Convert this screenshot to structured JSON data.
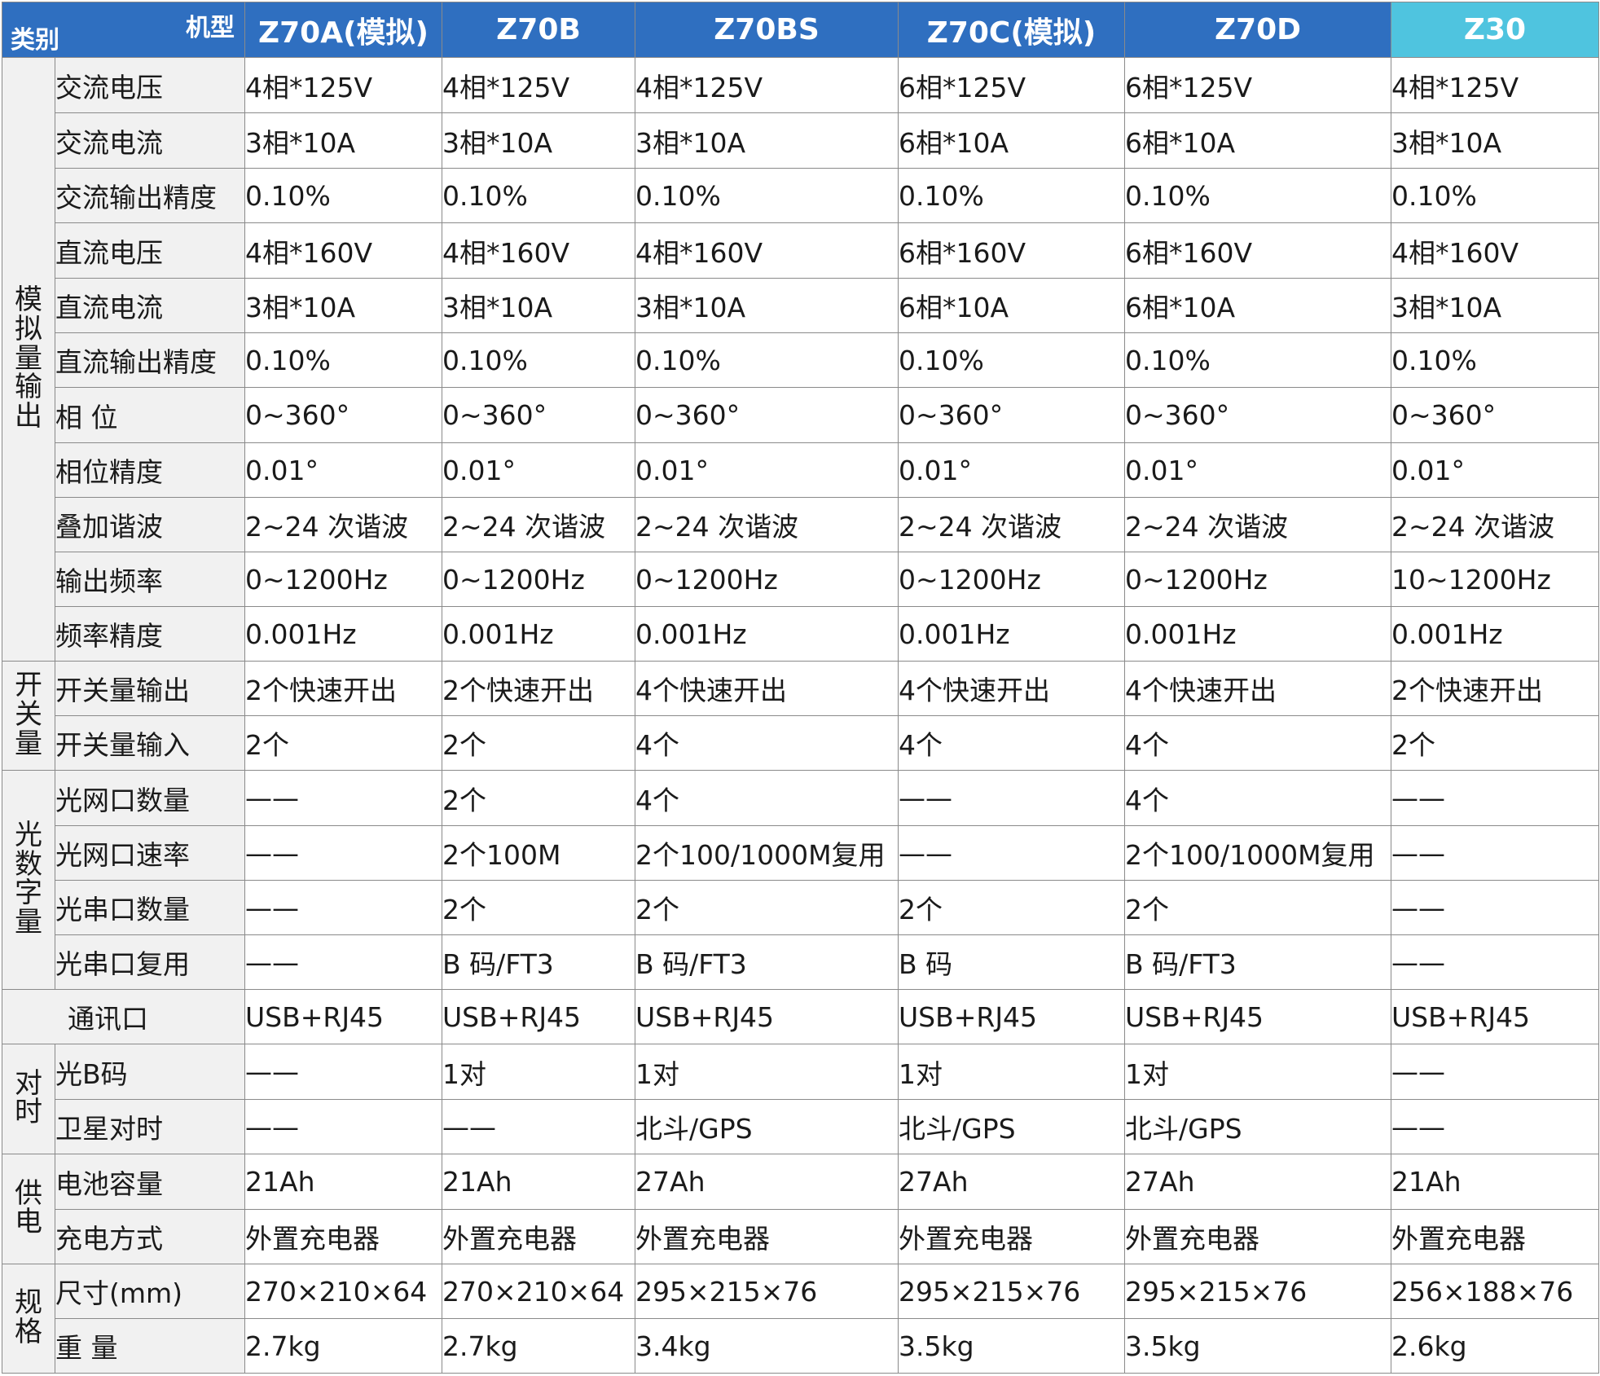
{
  "header": {
    "corner_class": "类别",
    "corner_model": "机型",
    "models": [
      "Z70A(模拟)",
      "Z70B",
      "Z70BS",
      "Z70C(模拟)",
      "Z70D",
      "Z30"
    ],
    "highlight_color": "#4fc4df",
    "header_color": "#2f6fc0"
  },
  "groups": [
    {
      "name": "模拟量输出",
      "rows": [
        {
          "param": "交流电压",
          "values": [
            "4相*125V",
            "4相*125V",
            "4相*125V",
            "6相*125V",
            "6相*125V",
            "4相*125V"
          ]
        },
        {
          "param": "交流电流",
          "values": [
            "3相*10A",
            "3相*10A",
            "3相*10A",
            "6相*10A",
            "6相*10A",
            "3相*10A"
          ]
        },
        {
          "param": "交流输出精度",
          "values": [
            "0.10%",
            "0.10%",
            "0.10%",
            "0.10%",
            "0.10%",
            "0.10%"
          ]
        },
        {
          "param": "直流电压",
          "values": [
            "4相*160V",
            "4相*160V",
            "4相*160V",
            "6相*160V",
            "6相*160V",
            "4相*160V"
          ]
        },
        {
          "param": "直流电流",
          "values": [
            "3相*10A",
            "3相*10A",
            "3相*10A",
            "6相*10A",
            "6相*10A",
            "3相*10A"
          ]
        },
        {
          "param": "直流输出精度",
          "values": [
            "0.10%",
            "0.10%",
            "0.10%",
            "0.10%",
            "0.10%",
            "0.10%"
          ]
        },
        {
          "param": "相 位",
          "values": [
            "0~360°",
            "0~360°",
            "0~360°",
            "0~360°",
            "0~360°",
            "0~360°"
          ]
        },
        {
          "param": "相位精度",
          "values": [
            "0.01°",
            "0.01°",
            "0.01°",
            "0.01°",
            "0.01°",
            "0.01°"
          ]
        },
        {
          "param": "叠加谐波",
          "values": [
            "2~24 次谐波",
            "2~24 次谐波",
            "2~24 次谐波",
            "2~24 次谐波",
            "2~24 次谐波",
            "2~24 次谐波"
          ]
        },
        {
          "param": "输出频率",
          "values": [
            "0~1200Hz",
            "0~1200Hz",
            "0~1200Hz",
            "0~1200Hz",
            "0~1200Hz",
            "10~1200Hz"
          ]
        },
        {
          "param": "频率精度",
          "values": [
            "0.001Hz",
            "0.001Hz",
            "0.001Hz",
            "0.001Hz",
            "0.001Hz",
            "0.001Hz"
          ]
        }
      ]
    },
    {
      "name": "开关量",
      "rows": [
        {
          "param": "开关量输出",
          "values": [
            "2个快速开出",
            "2个快速开出",
            "4个快速开出",
            "4个快速开出",
            "4个快速开出",
            "2个快速开出"
          ]
        },
        {
          "param": "开关量输入",
          "values": [
            "2个",
            "2个",
            "4个",
            "4个",
            "4个",
            "2个"
          ]
        }
      ]
    },
    {
      "name": "光数字量",
      "rows": [
        {
          "param": "光网口数量",
          "values": [
            "——",
            "2个",
            "4个",
            "——",
            "4个",
            "——"
          ]
        },
        {
          "param": "光网口速率",
          "values": [
            "——",
            "2个100M",
            "2个100/1000M复用",
            "——",
            "2个100/1000M复用",
            "——"
          ]
        },
        {
          "param": "光串口数量",
          "values": [
            "——",
            "2个",
            "2个",
            "2个",
            "2个",
            "——"
          ]
        },
        {
          "param": "光串口复用",
          "values": [
            "——",
            "B 码/FT3",
            "B 码/FT3",
            "B 码",
            "B 码/FT3",
            "——"
          ]
        }
      ]
    },
    {
      "name": "",
      "rows": [
        {
          "param": "通讯口",
          "values": [
            "USB+RJ45",
            "USB+RJ45",
            "USB+RJ45",
            "USB+RJ45",
            "USB+RJ45",
            "USB+RJ45"
          ]
        }
      ]
    },
    {
      "name": "对时",
      "rows": [
        {
          "param": "光B码",
          "values": [
            "——",
            "1对",
            "1对",
            "1对",
            "1对",
            "——"
          ]
        },
        {
          "param": "卫星对时",
          "values": [
            "——",
            "——",
            "北斗/GPS",
            "北斗/GPS",
            "北斗/GPS",
            "——"
          ]
        }
      ]
    },
    {
      "name": "供电",
      "rows": [
        {
          "param": "电池容量",
          "values": [
            "21Ah",
            "21Ah",
            "27Ah",
            "27Ah",
            "27Ah",
            "21Ah"
          ]
        },
        {
          "param": "充电方式",
          "values": [
            "外置充电器",
            "外置充电器",
            "外置充电器",
            "外置充电器",
            "外置充电器",
            "外置充电器"
          ]
        }
      ]
    },
    {
      "name": "规格",
      "rows": [
        {
          "param": "尺寸(mm)",
          "values": [
            "270×210×64",
            "270×210×64",
            "295×215×76",
            "295×215×76",
            "295×215×76",
            "256×188×76"
          ]
        },
        {
          "param": "重 量",
          "values": [
            "2.7kg",
            "2.7kg",
            "3.4kg",
            "3.5kg",
            "3.5kg",
            "2.6kg"
          ]
        }
      ]
    }
  ]
}
